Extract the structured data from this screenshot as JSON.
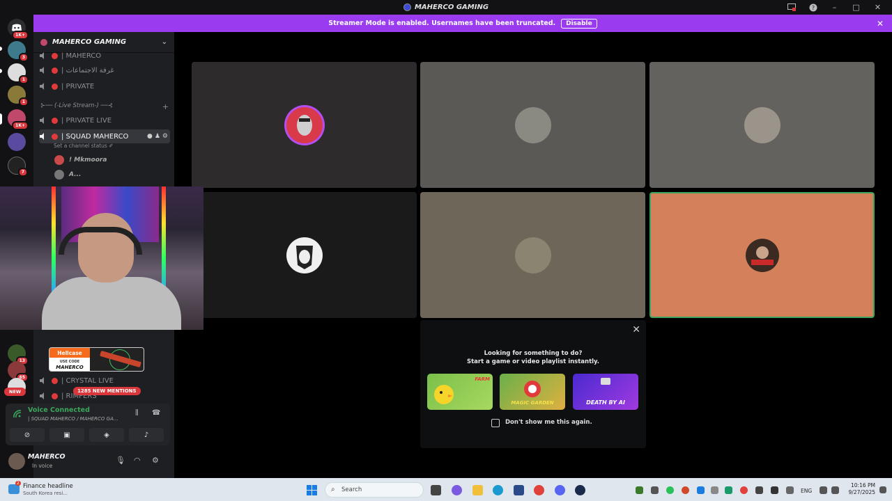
{
  "window": {
    "title": "MAHERCO GAMING"
  },
  "rail": {
    "badges": [
      "1K+",
      "3",
      "1",
      "1",
      "1K+",
      "1",
      "7",
      "13",
      "65"
    ],
    "new_label": "NEW"
  },
  "banner": {
    "text": "Streamer Mode is enabled. Usernames have been truncated.",
    "disable_label": "Disable"
  },
  "sidebar": {
    "server_name": "MAHERCO GAMING",
    "channels_top": [
      "| MAHERCO",
      "| غرفة الاجتماعات",
      "| PRIVATE"
    ],
    "category": "⊱── (-Live Stream-) ──⊰",
    "channels_live": [
      "| PRIVATE LIVE",
      "| SQUAD MAHERCO"
    ],
    "status_hint": "Set a channel status ✐",
    "members": [
      "! Mkmoora",
      "A..."
    ],
    "channels_bottom": [
      "| CRYSTAL LIVE",
      "| RIMPERS"
    ],
    "mentions": "1285 NEW MENTIONS"
  },
  "promo": {
    "brand": "Hellcase",
    "use_code": "USE CODE",
    "code": "MAHERCO"
  },
  "voice": {
    "status": "Voice Connected",
    "channel": "| SQUAD MAHERCO / MAHERCO GA..."
  },
  "user": {
    "name": "MAHERCO",
    "status": "In voice"
  },
  "popup": {
    "line1": "Looking for something to do?",
    "line2": "Start a game or video playlist instantly.",
    "games": [
      "FARM",
      "MAGIC GARDEN",
      "DEATH BY AI"
    ],
    "dont_show": "Don't show me this again."
  },
  "taskbar": {
    "news_title": "Finance headline",
    "news_sub": "South Korea resi...",
    "news_badge": "2",
    "search_placeholder": "Search",
    "lang": "ENG",
    "time": "10:16 PM",
    "date": "9/27/2025"
  },
  "colors": {
    "accent": "#9b3bf0",
    "voice_green": "#3ba55c",
    "live_red": "#e23a3a",
    "speaker_tile": "#d4805b"
  }
}
